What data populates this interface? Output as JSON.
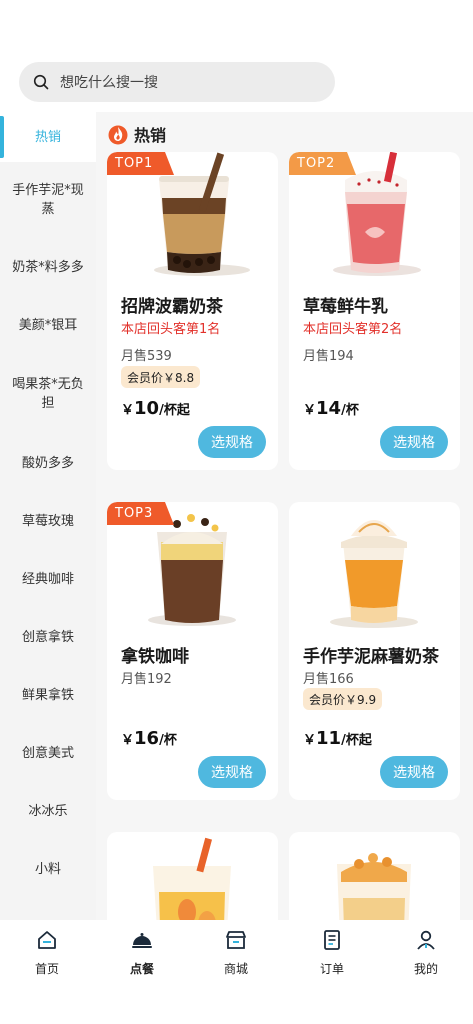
{
  "search": {
    "placeholder": "想吃什么搜一搜",
    "icon": "search-icon"
  },
  "sidebar": {
    "items": [
      {
        "label": "热销"
      },
      {
        "label": "手作芋泥*现蒸"
      },
      {
        "label": "奶茶*料多多"
      },
      {
        "label": "美颜*银耳"
      },
      {
        "label": "喝果茶*无负担"
      },
      {
        "label": "酸奶多多"
      },
      {
        "label": "草莓玫瑰"
      },
      {
        "label": "经典咖啡"
      },
      {
        "label": "创意拿铁"
      },
      {
        "label": "鲜果拿铁"
      },
      {
        "label": "创意美式"
      },
      {
        "label": "冰冰乐"
      },
      {
        "label": "小料"
      }
    ],
    "active_index": 0
  },
  "section": {
    "title": "热销",
    "icon": "fire-icon"
  },
  "products": [
    {
      "badge": "TOP1",
      "name": "招牌波霸奶茶",
      "rank": "本店回头客第1名",
      "sales": "月售539",
      "member": "会员价￥8.8",
      "price_sym": "￥",
      "price": "10",
      "unit": "/杯起",
      "button": "选规格"
    },
    {
      "badge": "TOP2",
      "name": "草莓鲜牛乳",
      "rank": "本店回头客第2名",
      "sales": "月售194",
      "member": "",
      "price_sym": "￥",
      "price": "14",
      "unit": "/杯",
      "button": "选规格"
    },
    {
      "badge": "TOP3",
      "name": "拿铁咖啡",
      "rank": "",
      "sales": "月售192",
      "member": "",
      "price_sym": "￥",
      "price": "16",
      "unit": "/杯",
      "button": "选规格"
    },
    {
      "badge": "",
      "name": "手作芋泥麻薯奶茶",
      "rank": "",
      "sales": "月售166",
      "member": "会员价￥9.9",
      "price_sym": "￥",
      "price": "11",
      "unit": "/杯起",
      "button": "选规格"
    }
  ],
  "tabbar": {
    "items": [
      {
        "label": "首页",
        "icon": "home-icon"
      },
      {
        "label": "点餐",
        "icon": "cloche-icon"
      },
      {
        "label": "商城",
        "icon": "store-icon"
      },
      {
        "label": "订单",
        "icon": "order-icon"
      },
      {
        "label": "我的",
        "icon": "profile-icon"
      }
    ],
    "active_index": 1
  },
  "colors": {
    "accent": "#4fb8df",
    "sidebar_active": "#34b3dc",
    "rank_red": "#e2302a",
    "badge_red": "#ef5a2a",
    "badge_orange": "#f39a47",
    "member_bg": "#fbe8cf"
  }
}
